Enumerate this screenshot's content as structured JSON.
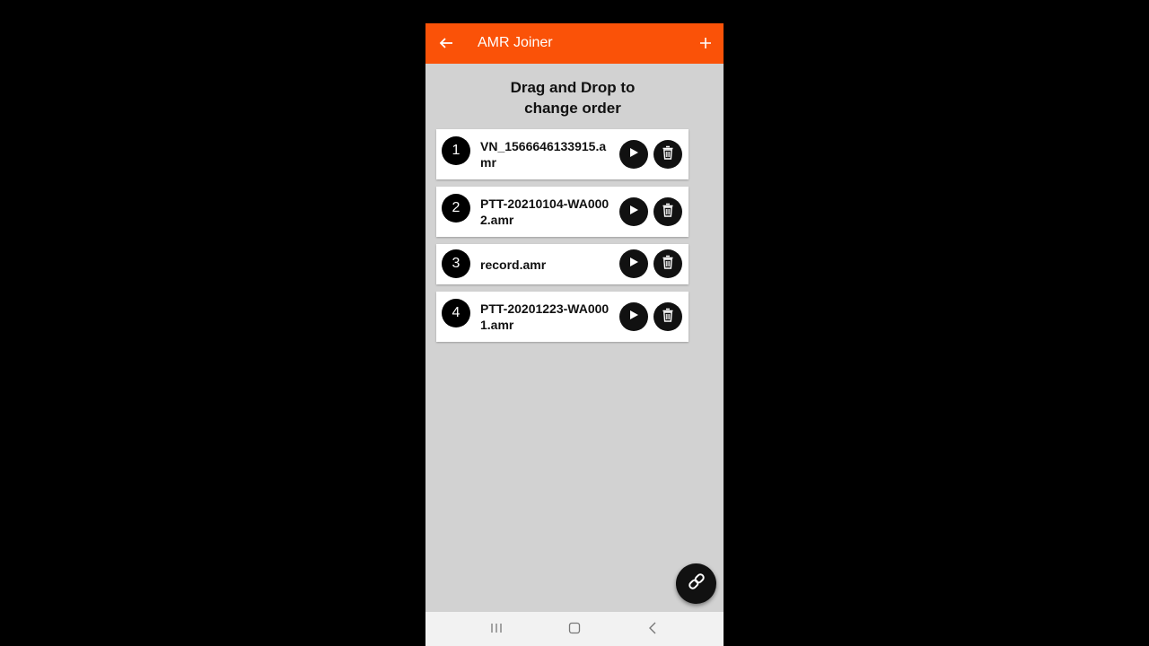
{
  "appbar": {
    "title": "AMR Joiner",
    "back_icon": "arrow-left-icon",
    "add_icon": "plus-icon",
    "color": "#fa5208"
  },
  "heading": {
    "line1": "Drag and Drop to",
    "line2": "change order"
  },
  "files": [
    {
      "index": "1",
      "name": "VN_1566646133915.amr"
    },
    {
      "index": "2",
      "name": "PTT-20210104-WA0002.amr"
    },
    {
      "index": "3",
      "name": "record.amr"
    },
    {
      "index": "4",
      "name": "PTT-20201223-WA0001.amr"
    }
  ],
  "fab": {
    "icon": "link-icon"
  },
  "navbar": {
    "recents_icon": "recents-icon",
    "home_icon": "home-icon",
    "back_icon": "nav-back-icon"
  }
}
